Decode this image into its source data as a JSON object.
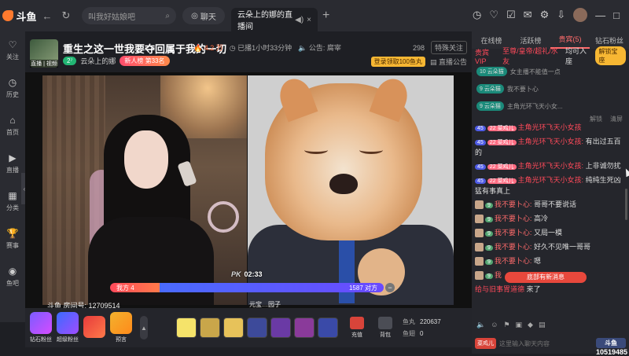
{
  "app": {
    "logo": "斗鱼"
  },
  "topbar": {
    "search_placeholder": "叫我好姑娘吧",
    "chat_label": "聊天",
    "tab_title": "云朵上的娜的直播间",
    "tab_close": "×",
    "tab_plus": "+"
  },
  "sidebar": {
    "items": [
      {
        "label": "关注",
        "icon": "♡"
      },
      {
        "label": "历史",
        "icon": "◷"
      },
      {
        "label": "首页",
        "icon": "⌂"
      },
      {
        "label": "直播",
        "icon": "▶"
      },
      {
        "label": "分类",
        "icon": "▦"
      },
      {
        "label": "赛事",
        "icon": "🏆"
      },
      {
        "label": "鱼吧",
        "icon": "◉"
      }
    ]
  },
  "room": {
    "avatar_tag": "直播 | 视频",
    "title": "重生之这一世我要夺回属于我的一切",
    "hot": "4.2 万",
    "live_time": "已播1小时33分钟",
    "announce": "公告: 腐宰",
    "level": "2⁷",
    "host": "云朵上的娜",
    "rank_label": "新人榜",
    "rank_value": "第33名",
    "fans_count": "298",
    "fans_btn": "特殊关注",
    "login_btn": "登录领取100鱼丸",
    "room_notice": "直播公告"
  },
  "video": {
    "pk_label": "PK",
    "pk_time": "02:33",
    "us_label": "我方 4",
    "us_pct": 0.18,
    "them_value": "1587 对方",
    "room_id": "斗鱼 房间号: 12709514",
    "partner_name": "元宝…园子"
  },
  "gifts": {
    "items": [
      {
        "label": "钻石粉丝"
      },
      {
        "label": "超级粉丝"
      },
      {
        "label": ""
      },
      {
        "label": "预言"
      }
    ],
    "recharge": "充值",
    "backpack": "背包",
    "fish_balance_label": "鱼丸",
    "fish_balance": "220637",
    "fish_ball_label": "鱼翅",
    "fish_ball": "0"
  },
  "chat": {
    "tabs": [
      "在线榜",
      "活跃榜",
      "贵宾(5)",
      "钻石粉丝"
    ],
    "active_tab": 2,
    "notice_prefix": "贵宾VIP",
    "notice_text": "至尊/皇帝/超礼/水友",
    "notice_tail": "均可入座",
    "unlock": "解锁宝座",
    "vip": [
      {
        "badge": "10 云朵猫",
        "text": "女主播不能值一点"
      },
      {
        "badge": "9 云朵猫",
        "text": "我不要卜心"
      },
      {
        "badge": "9 云朵猫",
        "text": "主角光环飞天小女..."
      }
    ],
    "tools": [
      "解锁",
      "清屏"
    ],
    "messages": [
      {
        "lv": "45",
        "fan": "22 菜鸡儿",
        "user": "主角光环飞天小女孩",
        "text": ""
      },
      {
        "lv": "45",
        "fan": "22 菜鸡儿",
        "user": "主角光环飞天小女孩:",
        "text": "有出过五百的"
      },
      {
        "lv": "45",
        "fan": "22 菜鸡儿",
        "user": "主角光环飞天小女孩:",
        "text": "上非诚勿扰"
      },
      {
        "lv": "45",
        "fan": "22 菜鸡儿",
        "user": "主角光环飞天小女孩:",
        "text": "纯纯生死凶猛有事真上"
      },
      {
        "lv": "",
        "fan": "9",
        "user": "我不要卜心:",
        "text": "哥哥不要说话"
      },
      {
        "lv": "",
        "fan": "9",
        "user": "我不要卜心:",
        "text": "高冷"
      },
      {
        "lv": "",
        "fan": "9",
        "user": "我不要卜心:",
        "text": "又局一模"
      },
      {
        "lv": "",
        "fan": "9",
        "user": "我不要卜心:",
        "text": "好久不见唯一哥哥"
      },
      {
        "lv": "",
        "fan": "9",
        "user": "我不要卜心:",
        "text": "嗯"
      },
      {
        "lv": "",
        "fan": "9",
        "user": "我",
        "text": ""
      },
      {
        "lv": "",
        "fan": "",
        "user": "给与旧事胃道德",
        "text": "来了"
      }
    ],
    "new_msg": "底部有新消息",
    "input_placeholder": "这里输入聊天内容",
    "fan_chip": "菜鸡儿",
    "watermark_logo": "斗鱼",
    "watermark_id": "10519485"
  }
}
